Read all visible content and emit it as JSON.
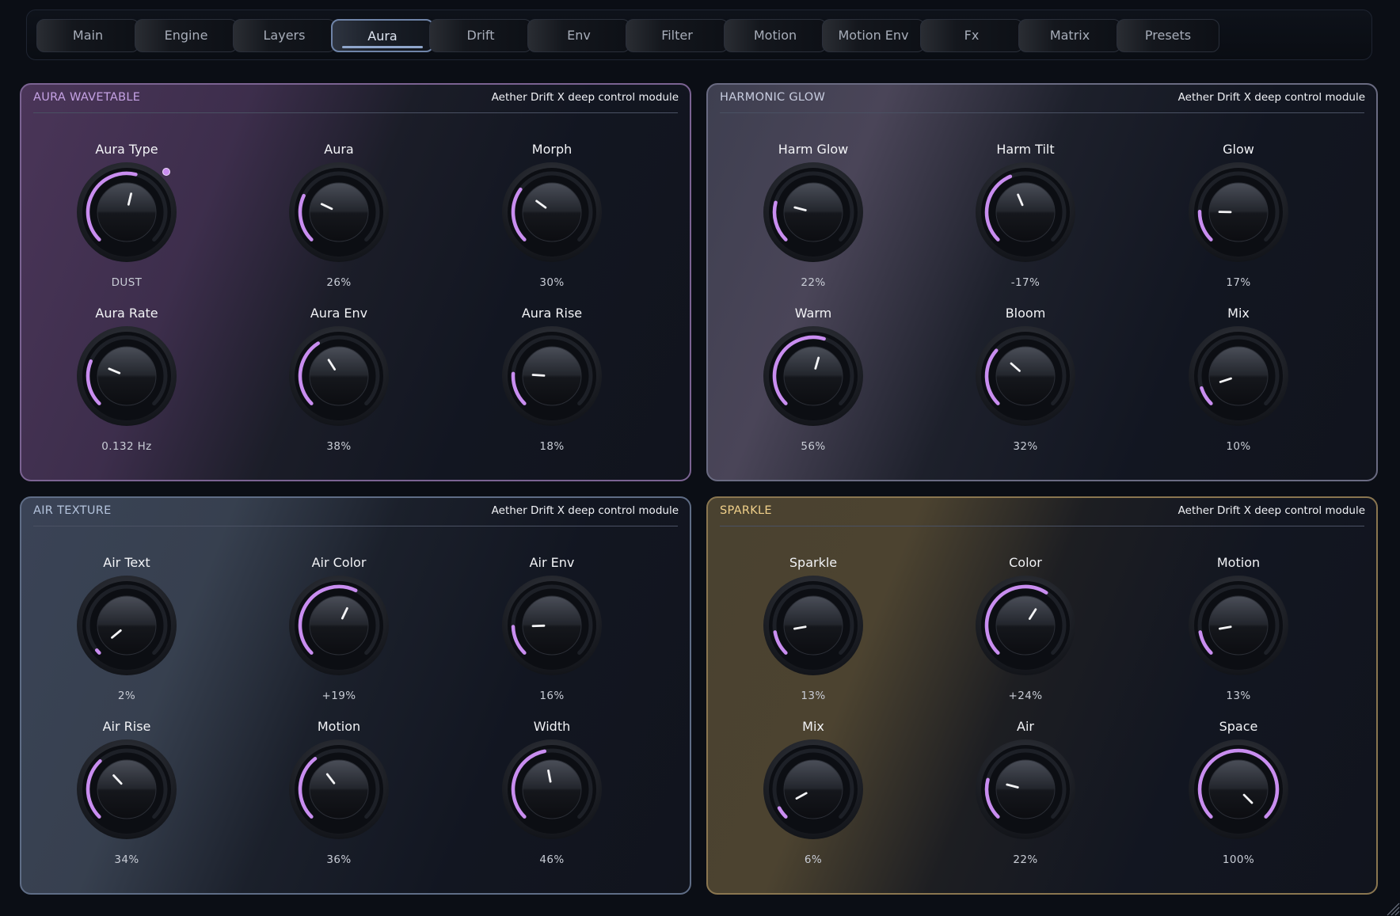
{
  "tabs": [
    {
      "label": "Main",
      "active": false
    },
    {
      "label": "Engine",
      "active": false
    },
    {
      "label": "Layers",
      "active": false
    },
    {
      "label": "Aura",
      "active": true
    },
    {
      "label": "Drift",
      "active": false
    },
    {
      "label": "Env",
      "active": false
    },
    {
      "label": "Filter",
      "active": false
    },
    {
      "label": "Motion",
      "active": false
    },
    {
      "label": "Motion Env",
      "active": false
    },
    {
      "label": "Fx",
      "active": false
    },
    {
      "label": "Matrix",
      "active": false
    },
    {
      "label": "Presets",
      "active": false
    }
  ],
  "accent_color": "#c98df0",
  "panels": [
    {
      "title": "AURA WAVETABLE",
      "subtitle": "Aether Drift X deep control module",
      "knobs": [
        {
          "label": "Aura Type",
          "value": "DUST",
          "level": 0.55,
          "dot": true
        },
        {
          "label": "Aura",
          "value": "26%",
          "level": 0.26
        },
        {
          "label": "Morph",
          "value": "30%",
          "level": 0.3
        },
        {
          "label": "Aura Rate",
          "value": "0.132 Hz",
          "level": 0.25
        },
        {
          "label": "Aura Env",
          "value": "38%",
          "level": 0.38
        },
        {
          "label": "Aura Rise",
          "value": "18%",
          "level": 0.18
        }
      ]
    },
    {
      "title": "HARMONIC GLOW",
      "subtitle": "Aether Drift X deep control module",
      "knobs": [
        {
          "label": "Harm Glow",
          "value": "22%",
          "level": 0.22
        },
        {
          "label": "Harm Tilt",
          "value": "-17%",
          "level": 0.415
        },
        {
          "label": "Glow",
          "value": "17%",
          "level": 0.17
        },
        {
          "label": "Warm",
          "value": "56%",
          "level": 0.56
        },
        {
          "label": "Bloom",
          "value": "32%",
          "level": 0.32
        },
        {
          "label": "Mix",
          "value": "10%",
          "level": 0.1
        }
      ]
    },
    {
      "title": "AIR TEXTURE",
      "subtitle": "Aether Drift X deep control module",
      "knobs": [
        {
          "label": "Air Text",
          "value": "2%",
          "level": 0.02
        },
        {
          "label": "Air Color",
          "value": "+19%",
          "level": 0.595
        },
        {
          "label": "Air Env",
          "value": "16%",
          "level": 0.16
        },
        {
          "label": "Air Rise",
          "value": "34%",
          "level": 0.34
        },
        {
          "label": "Motion",
          "value": "36%",
          "level": 0.36
        },
        {
          "label": "Width",
          "value": "46%",
          "level": 0.46
        }
      ]
    },
    {
      "title": "SPARKLE",
      "subtitle": "Aether Drift X deep control module",
      "knobs": [
        {
          "label": "Sparkle",
          "value": "13%",
          "level": 0.13
        },
        {
          "label": "Color",
          "value": "+24%",
          "level": 0.62
        },
        {
          "label": "Motion",
          "value": "13%",
          "level": 0.13
        },
        {
          "label": "Mix",
          "value": "6%",
          "level": 0.06
        },
        {
          "label": "Air",
          "value": "22%",
          "level": 0.22
        },
        {
          "label": "Space",
          "value": "100%",
          "level": 1.0
        }
      ]
    }
  ]
}
